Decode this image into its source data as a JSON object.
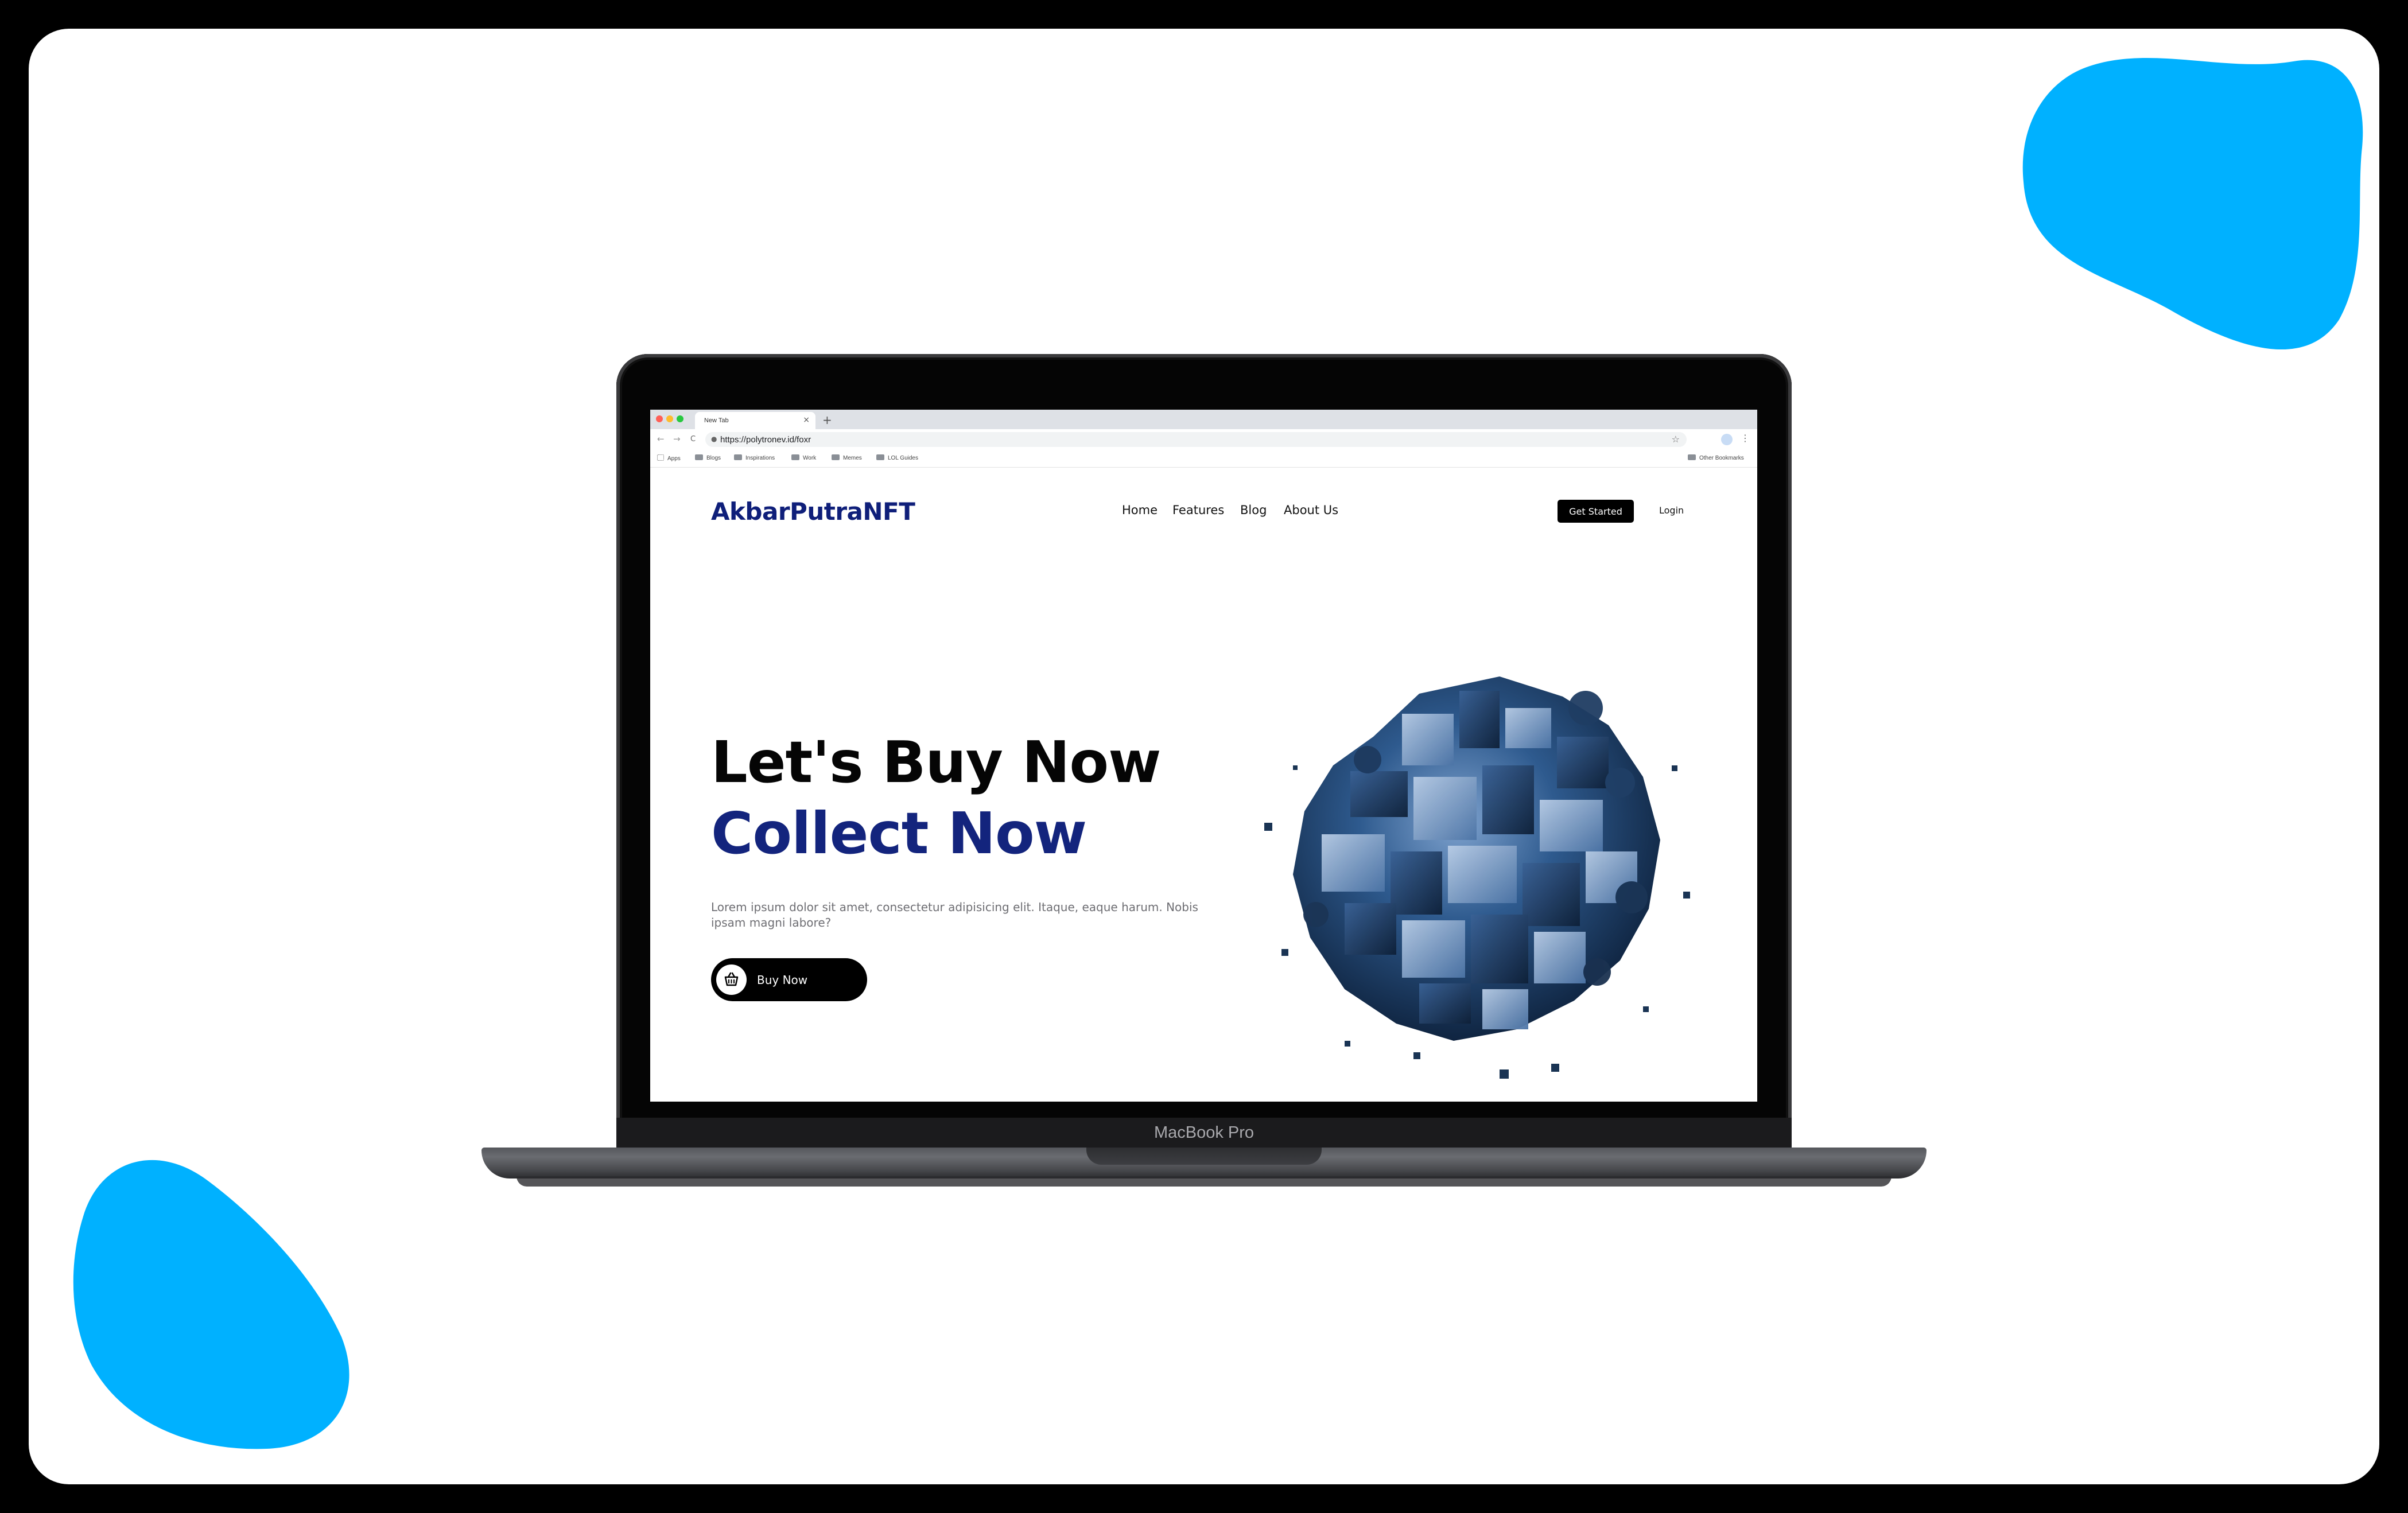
{
  "browser": {
    "tab_title": "New Tab",
    "tab_close": "×",
    "new_tab": "+",
    "url": "https://polytronev.id/foxr",
    "back": "←",
    "forward": "→",
    "reload": "C",
    "star": "☆",
    "menu": "⋮",
    "bookmarks": [
      "Apps",
      "Blogs",
      "Inspirations",
      "Work",
      "Memes",
      "LOL Guides"
    ],
    "other_bookmarks": "Other Bookmarks"
  },
  "site": {
    "logo": "AkbarPutraNFT",
    "nav": [
      "Home",
      "Features",
      "Blog",
      "About Us"
    ],
    "cta": "Get Started",
    "login": "Login",
    "headline_line1": "Let's Buy Now",
    "headline_line2": "Collect Now",
    "description": "Lorem ipsum dolor sit amet, consectetur adipisicing elit. Itaque, eaque harum. Nobis ipsam magni labore?",
    "buy_button": "Buy Now"
  },
  "device": {
    "brand": "MacBook Pro"
  },
  "colors": {
    "accent_blue": "#00b1ff",
    "brand_navy": "#13247d",
    "frame": "#000000"
  },
  "icons": [
    "cart-icon",
    "lock-icon",
    "star-icon",
    "profile-icon"
  ]
}
